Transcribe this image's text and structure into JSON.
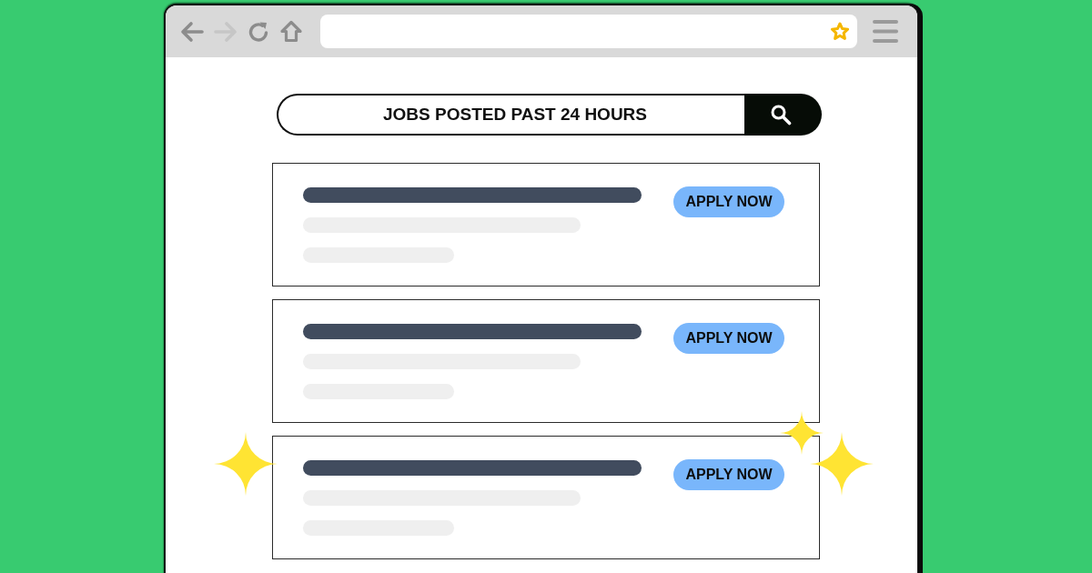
{
  "toolbar": {
    "back": {
      "disabled": false
    },
    "forward": {
      "disabled": true
    }
  },
  "search": {
    "value": "JOBS POSTED PAST 24 HOURS"
  },
  "job_listings": [
    {
      "button": "APPLY NOW"
    },
    {
      "button": "APPLY NOW"
    },
    {
      "button": "APPLY NOW"
    }
  ]
}
